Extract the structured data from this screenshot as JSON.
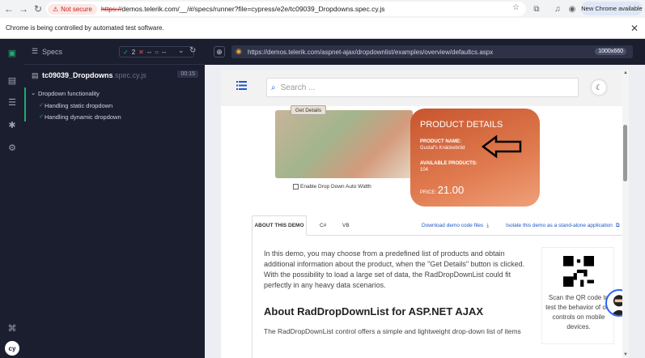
{
  "browser": {
    "not_secure": "Not secure",
    "url_scheme": "https://",
    "url_rest": "demos.telerik.com/__/#/specs/runner?file=cypress/e2e/tc09039_Dropdowns.spec.cy.js",
    "chrome_available": "New Chrome available",
    "info_message": "Chrome is being controlled by automated test software."
  },
  "cypress": {
    "specs_label": "Specs",
    "passed_count": "2",
    "failed_count": "--",
    "pending_count": "--",
    "spec_file": "tc09039_Dropdowns",
    "spec_ext": ".spec.cy.js",
    "duration": "00:15",
    "suite_title": "Dropdown functionality",
    "tests": [
      "Handling static dropdown",
      "Handling dynamic dropdown"
    ],
    "preview_url": "https://demos.telerik.com/aspnet-ajax/dropdownlist/examples/overview/defaultcs.aspx",
    "viewport": "1000x660"
  },
  "demo": {
    "search_placeholder": "Search ...",
    "get_details": "Get Details",
    "checkbox_label": "Enable Drop Down Auto Width",
    "card_title": "PRODUCT DETAILS",
    "product_name_label": "PRODUCT NAME:",
    "product_name_value": "Gustaf's Knäckebröd",
    "available_label": "AVAILABLE PRODUCTS:",
    "available_value": "104",
    "price_label": "PRICE:",
    "price_value": "21.00",
    "tabs": [
      "ABOUT THIS DEMO",
      "C#",
      "VB"
    ],
    "download_link": "Download demo code files",
    "standalone_link": "Isolate this demo as a stand-alone application",
    "paragraph": "In this demo, you may choose from a predefined list of products and obtain additional information about the product, when the \"Get Details\" button is clicked. With the possibility to load a large set of data, the RadDropDownList could fit perfectly in any heavy data scenarios.",
    "about_title": "About RadDropDownList for ASP.NET AJAX",
    "paragraph2": "The RadDropDownList control offers a simple and lightweight drop-down list of items",
    "qr_text": "Scan the QR code to test the behavior of our controls on mobile devices."
  },
  "colors": {
    "cypress_bg": "#1b1e2e",
    "pass_green": "#1fa971",
    "card_orange": "#e07b4f",
    "link_blue": "#1e57c7"
  }
}
